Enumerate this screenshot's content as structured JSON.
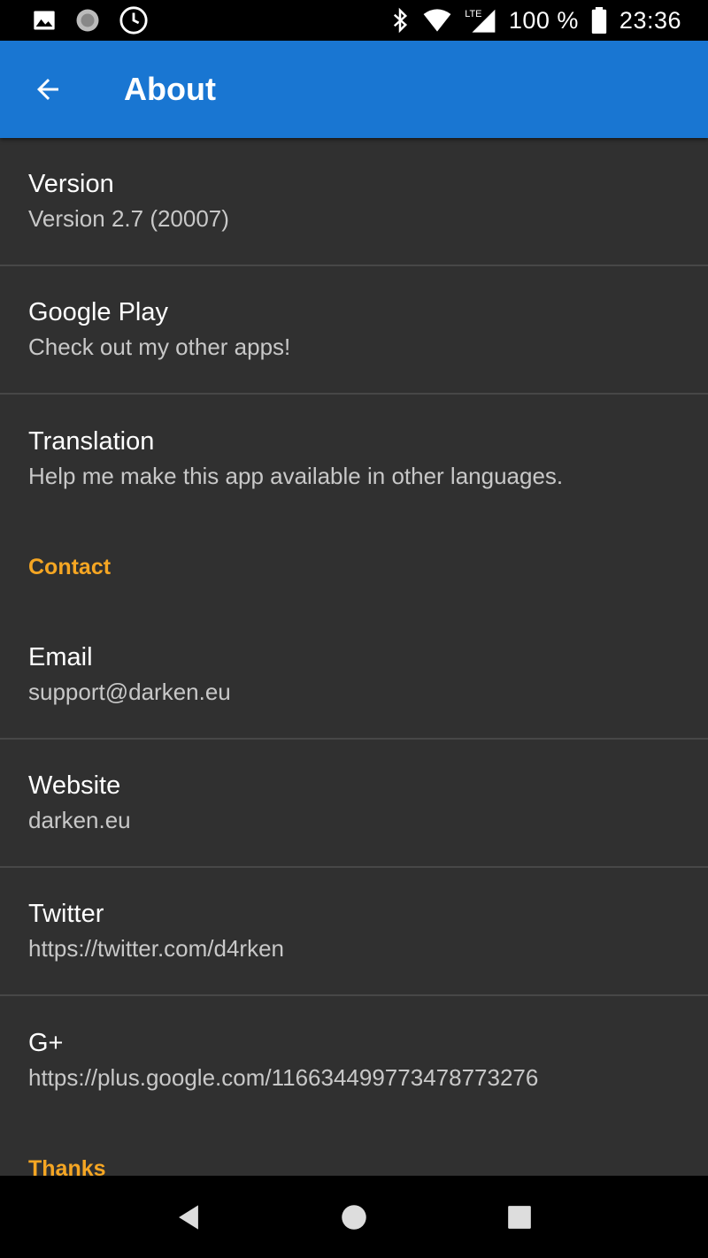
{
  "status_bar": {
    "battery_text": "100 %",
    "time": "23:36",
    "network_label": "LTE",
    "icons_left": [
      "image-icon",
      "sync-circle-icon",
      "clock-icon"
    ],
    "icons_right": [
      "bluetooth-icon",
      "wifi-icon",
      "signal-icon",
      "battery-icon"
    ]
  },
  "app_bar": {
    "title": "About",
    "color": "#1976d2"
  },
  "items": [
    {
      "title": "Version",
      "summary": "Version 2.7 (20007)"
    },
    {
      "title": "Google Play",
      "summary": "Check out my other apps!"
    },
    {
      "title": "Translation",
      "summary": "Help me make this app available in other languages."
    }
  ],
  "contact": {
    "header": "Contact",
    "items": [
      {
        "title": "Email",
        "summary": "support@darken.eu"
      },
      {
        "title": "Website",
        "summary": "darken.eu"
      },
      {
        "title": "Twitter",
        "summary": "https://twitter.com/d4rken"
      },
      {
        "title": "G+",
        "summary": "https://plus.google.com/116634499773478773276"
      }
    ]
  },
  "thanks": {
    "header": "Thanks"
  },
  "colors": {
    "accent": "#f5a623",
    "background": "#303030",
    "divider": "#474747"
  }
}
